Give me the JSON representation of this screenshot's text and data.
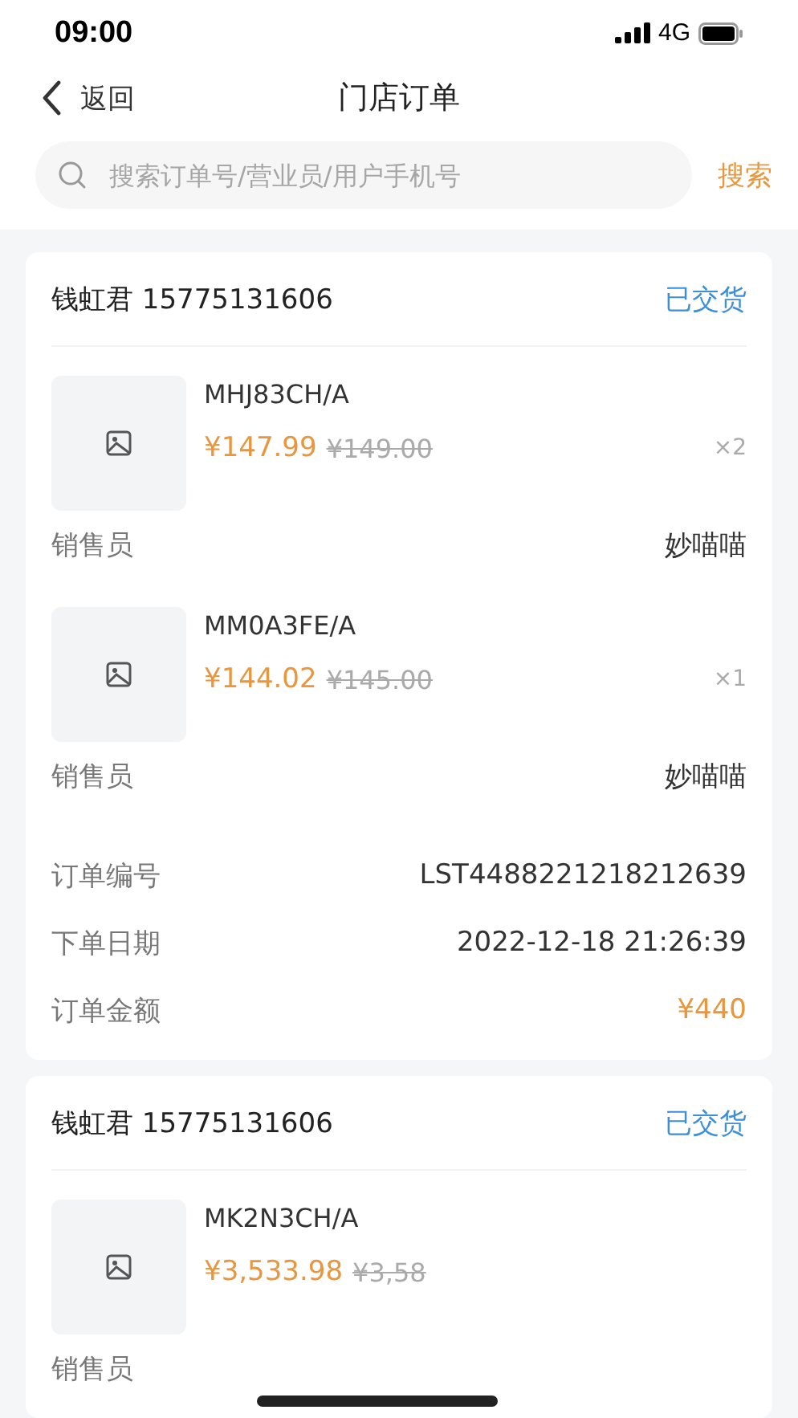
{
  "status_bar": {
    "time": "09:00",
    "network": "4G"
  },
  "nav": {
    "back_label": "返回",
    "title": "门店订单"
  },
  "search": {
    "placeholder": "搜索订单号/营业员/用户手机号",
    "button": "搜索"
  },
  "orders": [
    {
      "customer": "钱虹君 15775131606",
      "status": "已交货",
      "items": [
        {
          "model": "MHJ83CH/A",
          "price": "¥147.99",
          "original_price": "¥149.00",
          "quantity": "×2",
          "seller_label": "销售员",
          "seller": "妙喵喵"
        },
        {
          "model": "MM0A3FE/A",
          "price": "¥144.02",
          "original_price": "¥145.00",
          "quantity": "×1",
          "seller_label": "销售员",
          "seller": "妙喵喵"
        }
      ],
      "details": [
        {
          "label": "订单编号",
          "value": "LST4488221218212639",
          "kind": "text"
        },
        {
          "label": "下单日期",
          "value": "2022-12-18 21:26:39",
          "kind": "text"
        },
        {
          "label": "订单金额",
          "value": "¥440",
          "kind": "amount"
        }
      ]
    },
    {
      "customer": "钱虹君 15775131606",
      "status": "已交货",
      "items": [
        {
          "model": "MK2N3CH/A",
          "price": "¥3,533.98",
          "original_price": "¥3,58",
          "seller_label": "销售员"
        }
      ]
    }
  ]
}
